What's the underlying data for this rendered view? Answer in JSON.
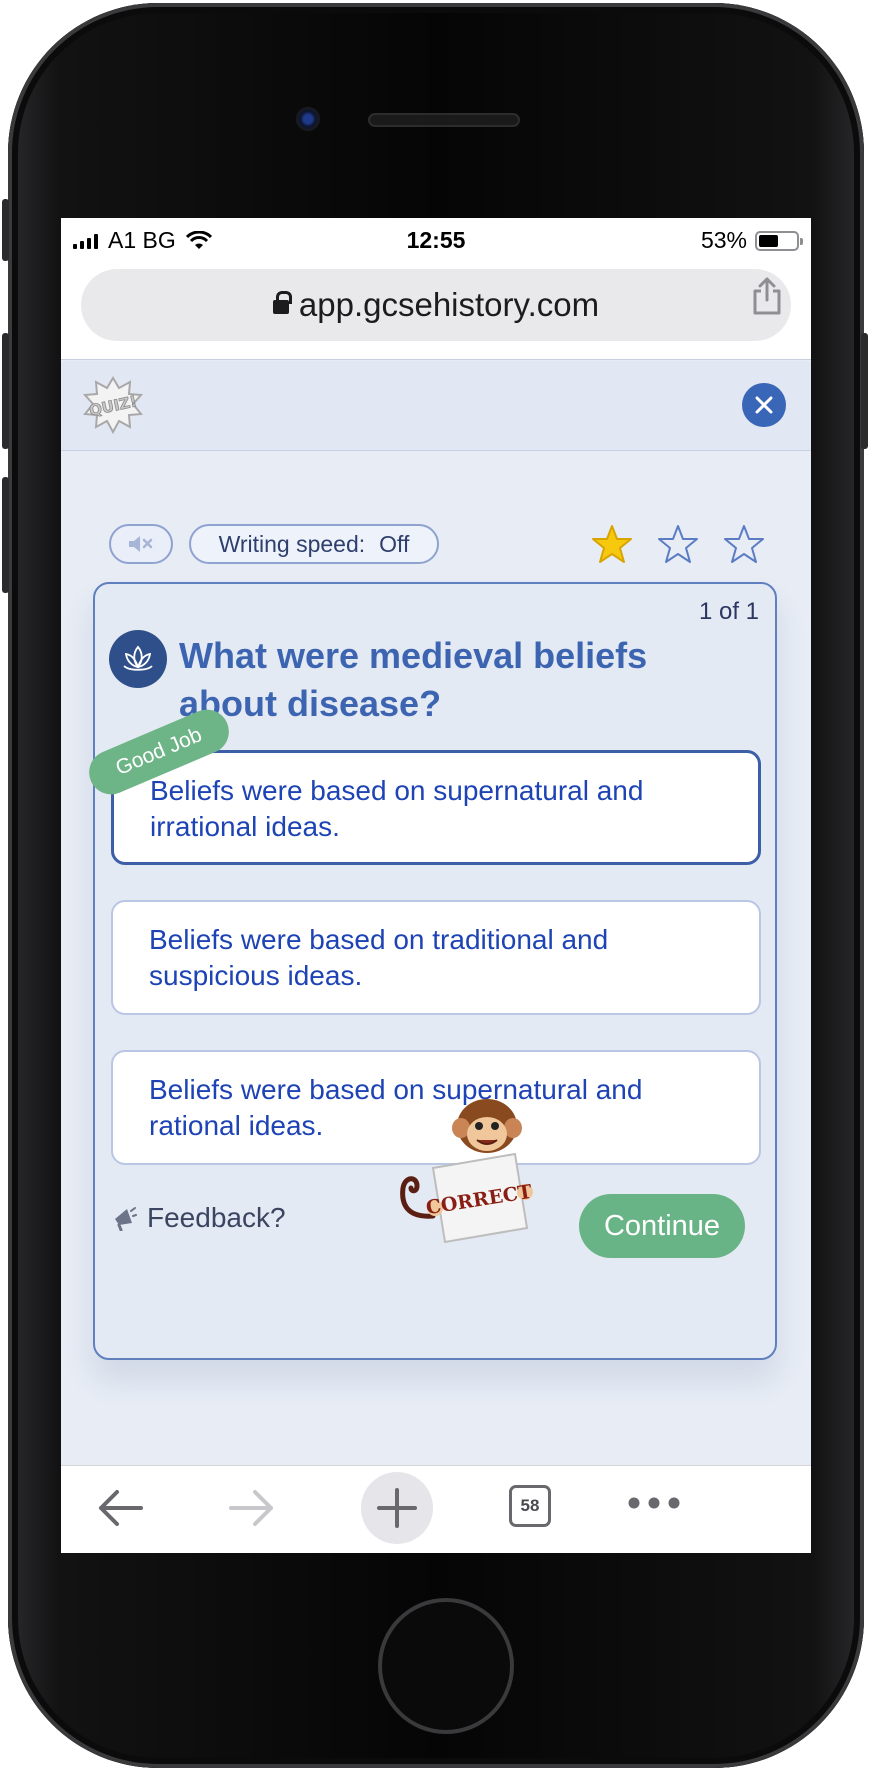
{
  "status_bar": {
    "carrier": "A1 BG",
    "time": "12:55",
    "battery": "53%"
  },
  "browser": {
    "url": "app.gcsehistory.com",
    "tabs_count": "58"
  },
  "quiz_header": {
    "logo_icon": "quiz-logo-icon",
    "close_icon": "close-icon"
  },
  "controls": {
    "mute_icon": "speaker-muted-icon",
    "writing_speed_label": "Writing speed:",
    "writing_speed_value": "Off",
    "stars_earned": 1,
    "stars_total": 3
  },
  "question_card": {
    "counter": "1 of 1",
    "question": "What were medieval beliefs about disease?",
    "options": [
      {
        "text": "Beliefs were based on supernatural and irrational ideas.",
        "selected": true
      },
      {
        "text": "Beliefs were based on traditional and suspicious ideas.",
        "selected": false
      },
      {
        "text": "Beliefs were based on supernatural and rational ideas.",
        "selected": false
      }
    ],
    "badge": "Good Job",
    "mascot_sign": "CORRECT",
    "feedback_label": "Feedback?",
    "continue_label": "Continue"
  },
  "colors": {
    "accent_blue": "#3a66b7",
    "question_text": "#3c64b0",
    "option_text": "#1d43b4",
    "success_green": "#69b487",
    "star_gold": "#f6c90e"
  }
}
